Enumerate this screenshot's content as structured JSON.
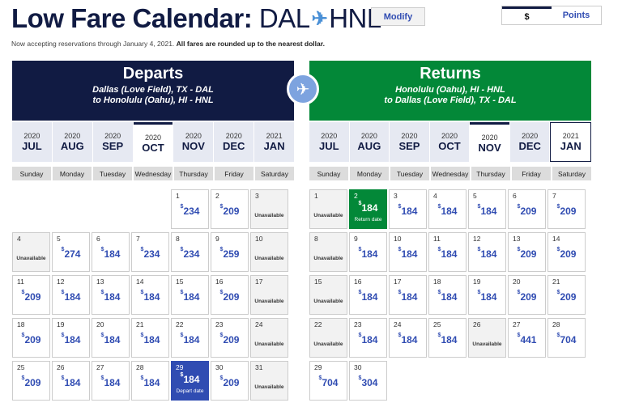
{
  "header": {
    "title_prefix": "Low Fare Calendar:",
    "origin": "DAL",
    "destination": "HNL",
    "plane_icon": "✈",
    "modify_label": "Modify",
    "currency_label": "$",
    "points_label": "Points"
  },
  "notice": {
    "text": "Now accepting reservations through January 4, 2021.",
    "bold": "All fares are rounded up to the nearest dollar."
  },
  "colors": {
    "navy": "#111b43",
    "green": "#038838",
    "fare_blue": "#304cb2",
    "plane_circle": "#7da3df"
  },
  "swap_icon": "✈",
  "weekdays": [
    "Sunday",
    "Monday",
    "Tuesday",
    "Wednesday",
    "Thursday",
    "Friday",
    "Saturday"
  ],
  "departs": {
    "title": "Departs",
    "line1": "Dallas (Love Field), TX - DAL",
    "line2": "to  Honolulu (Oahu), HI - HNL",
    "months": [
      {
        "year": "2020",
        "month": "JUL"
      },
      {
        "year": "2020",
        "month": "AUG"
      },
      {
        "year": "2020",
        "month": "SEP"
      },
      {
        "year": "2020",
        "month": "OCT",
        "selected": true
      },
      {
        "year": "2020",
        "month": "NOV"
      },
      {
        "year": "2020",
        "month": "DEC"
      },
      {
        "year": "2021",
        "month": "JAN"
      }
    ],
    "leading_blanks": 4,
    "days": [
      {
        "day": "1",
        "price": "234"
      },
      {
        "day": "2",
        "price": "209"
      },
      {
        "day": "3",
        "price": "",
        "label": "Unavailable"
      },
      {
        "day": "4",
        "price": "",
        "label": "Unavailable"
      },
      {
        "day": "5",
        "price": "274"
      },
      {
        "day": "6",
        "price": "184"
      },
      {
        "day": "7",
        "price": "234"
      },
      {
        "day": "8",
        "price": "234"
      },
      {
        "day": "9",
        "price": "259"
      },
      {
        "day": "10",
        "price": "",
        "label": "Unavailable"
      },
      {
        "day": "11",
        "price": "209"
      },
      {
        "day": "12",
        "price": "184"
      },
      {
        "day": "13",
        "price": "184"
      },
      {
        "day": "14",
        "price": "184"
      },
      {
        "day": "15",
        "price": "184"
      },
      {
        "day": "16",
        "price": "209"
      },
      {
        "day": "17",
        "price": "",
        "label": "Unavailable"
      },
      {
        "day": "18",
        "price": "209"
      },
      {
        "day": "19",
        "price": "184"
      },
      {
        "day": "20",
        "price": "184"
      },
      {
        "day": "21",
        "price": "184"
      },
      {
        "day": "22",
        "price": "184"
      },
      {
        "day": "23",
        "price": "209"
      },
      {
        "day": "24",
        "price": "",
        "label": "Unavailable"
      },
      {
        "day": "25",
        "price": "209"
      },
      {
        "day": "26",
        "price": "184"
      },
      {
        "day": "27",
        "price": "184"
      },
      {
        "day": "28",
        "price": "184"
      },
      {
        "day": "29",
        "price": "184",
        "tag": "Depart date",
        "state": "dep-sel"
      },
      {
        "day": "30",
        "price": "209"
      },
      {
        "day": "31",
        "price": "",
        "label": "Unavailable"
      }
    ]
  },
  "returns": {
    "title": "Returns",
    "line1": "Honolulu (Oahu), HI - HNL",
    "line2": "to  Dallas (Love Field), TX - DAL",
    "months": [
      {
        "year": "2020",
        "month": "JUL"
      },
      {
        "year": "2020",
        "month": "AUG"
      },
      {
        "year": "2020",
        "month": "SEP"
      },
      {
        "year": "2020",
        "month": "OCT"
      },
      {
        "year": "2020",
        "month": "NOV",
        "selected": true
      },
      {
        "year": "2020",
        "month": "DEC"
      },
      {
        "year": "2021",
        "month": "JAN",
        "framed": true
      }
    ],
    "leading_blanks": 0,
    "days": [
      {
        "day": "1",
        "price": "",
        "label": "Unavailable"
      },
      {
        "day": "2",
        "price": "184",
        "tag": "Return date",
        "state": "ret-sel"
      },
      {
        "day": "3",
        "price": "184"
      },
      {
        "day": "4",
        "price": "184"
      },
      {
        "day": "5",
        "price": "184"
      },
      {
        "day": "6",
        "price": "209"
      },
      {
        "day": "7",
        "price": "209"
      },
      {
        "day": "8",
        "price": "",
        "label": "Unavailable"
      },
      {
        "day": "9",
        "price": "184"
      },
      {
        "day": "10",
        "price": "184"
      },
      {
        "day": "11",
        "price": "184"
      },
      {
        "day": "12",
        "price": "184"
      },
      {
        "day": "13",
        "price": "209"
      },
      {
        "day": "14",
        "price": "209"
      },
      {
        "day": "15",
        "price": "",
        "label": "Unavailable"
      },
      {
        "day": "16",
        "price": "184"
      },
      {
        "day": "17",
        "price": "184"
      },
      {
        "day": "18",
        "price": "184"
      },
      {
        "day": "19",
        "price": "184"
      },
      {
        "day": "20",
        "price": "209"
      },
      {
        "day": "21",
        "price": "209"
      },
      {
        "day": "22",
        "price": "",
        "label": "Unavailable"
      },
      {
        "day": "23",
        "price": "184"
      },
      {
        "day": "24",
        "price": "184"
      },
      {
        "day": "25",
        "price": "184"
      },
      {
        "day": "26",
        "price": "",
        "label": "Unavailable"
      },
      {
        "day": "27",
        "price": "441"
      },
      {
        "day": "28",
        "price": "704"
      },
      {
        "day": "29",
        "price": "704"
      },
      {
        "day": "30",
        "price": "304"
      }
    ]
  }
}
